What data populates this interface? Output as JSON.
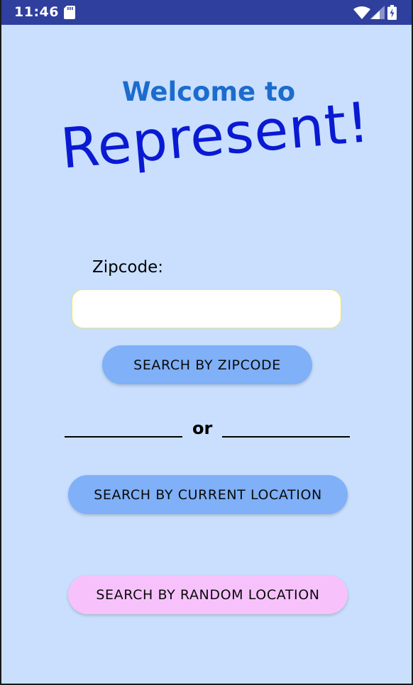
{
  "status_bar": {
    "time": "11:46",
    "icons": [
      "sd-card-icon",
      "wifi-icon",
      "signal-icon",
      "battery-charging-icon"
    ]
  },
  "welcome": {
    "title": "Welcome to",
    "app_name": "Represent!"
  },
  "zipcode": {
    "label": "Zipcode:",
    "value": "",
    "placeholder": ""
  },
  "buttons": {
    "search_zip": "SEARCH BY ZIPCODE",
    "separator": "or",
    "search_current": "SEARCH BY CURRENT LOCATION",
    "search_random": "SEARCH BY RANDOM LOCATION"
  },
  "colors": {
    "background": "#c9dffd",
    "status_bar": "#2f3f9e",
    "title": "#1c6ccd",
    "app_name": "#0a1ad2",
    "primary_button": "#7fb0f8",
    "random_button": "#f7c2fc",
    "input_border": "#f0e46a"
  }
}
